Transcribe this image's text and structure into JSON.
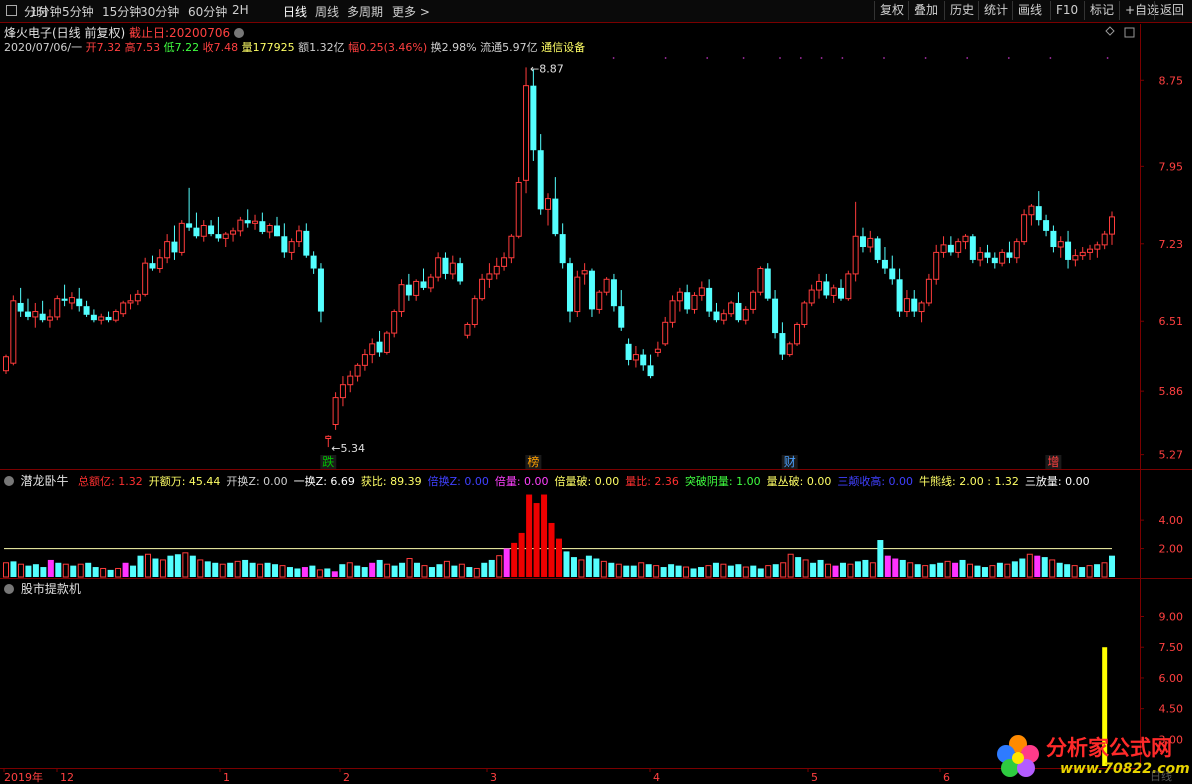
{
  "toolbar": {
    "left": [
      "分时",
      "1分钟",
      "5分钟",
      "15分钟",
      "30分钟",
      "60分钟",
      "2H",
      "日线",
      "周线",
      "多周期",
      "更多 >"
    ],
    "active": "日线",
    "right": [
      "复权",
      "叠加",
      "历史",
      "统计",
      "画线",
      "F10",
      "标记",
      "+自选",
      "返回"
    ]
  },
  "header": {
    "name": "烽火电子(日线 前复权)",
    "cutoff": "截止日:20200706",
    "date": "2020/07/06/一",
    "open": "开7.32",
    "high": "高7.53",
    "low": "低7.22",
    "close": "收7.48",
    "volume": "量177925",
    "amount": "额1.32亿",
    "change": "幅0.25(3.46%)",
    "turnover": "换2.98%",
    "float": "流通5.97亿",
    "sector": "通信设备"
  },
  "indicator1": {
    "name": "潜龙卧牛",
    "items": [
      {
        "text": "总额亿: 1.32",
        "color": "#ff3030"
      },
      {
        "text": "开额万: 45.44",
        "color": "#ffff66"
      },
      {
        "text": "开换Z: 0.00",
        "color": "#d0d0d0"
      },
      {
        "text": "一换Z: 6.69",
        "color": "#ffffff"
      },
      {
        "text": "获比: 89.39",
        "color": "#ffff66"
      },
      {
        "text": "倍换Z: 0.00",
        "color": "#4040ff"
      },
      {
        "text": "倍量: 0.00",
        "color": "#ff40ff"
      },
      {
        "text": "倍量破: 0.00",
        "color": "#ffff66"
      },
      {
        "text": "量比: 2.36",
        "color": "#ff3030"
      },
      {
        "text": "突破阴量: 1.00",
        "color": "#40ff40"
      },
      {
        "text": "量丛破: 0.00",
        "color": "#ffff66"
      },
      {
        "text": "三颠收高: 0.00",
        "color": "#4040ff"
      },
      {
        "text": "牛熊线: 2.00 : 1.32",
        "color": "#ffff66"
      },
      {
        "text": "三放量: 0.00",
        "color": "#ffffff"
      }
    ]
  },
  "indicator2": {
    "name": "股市提款机"
  },
  "logo": {
    "title": "分析家公式网",
    "url": "www.70822.com",
    "corner": "日线"
  },
  "chart_data": [
    {
      "type": "candlestick",
      "yticks": [
        8.75,
        7.95,
        7.23,
        6.51,
        5.86,
        5.27
      ],
      "ylim": [
        5.22,
        8.92
      ],
      "xticks": [
        "2019年",
        "12",
        "1",
        "2",
        "3",
        "4",
        "5",
        "6"
      ],
      "annotations": [
        {
          "text": "8.87",
          "kind": "high"
        },
        {
          "text": "5.34",
          "kind": "low"
        },
        {
          "text": "跌",
          "color": "#00c000"
        },
        {
          "text": "榜",
          "color": "#ffa000"
        },
        {
          "text": "财",
          "color": "#4aa0ff"
        },
        {
          "text": "增",
          "color": "#ff4040"
        }
      ],
      "ohlc": [
        [
          6.05,
          6.2,
          6.02,
          6.18
        ],
        [
          6.12,
          6.75,
          6.1,
          6.7
        ],
        [
          6.68,
          6.82,
          6.55,
          6.6
        ],
        [
          6.6,
          6.72,
          6.52,
          6.55
        ],
        [
          6.55,
          6.68,
          6.45,
          6.6
        ],
        [
          6.58,
          6.7,
          6.5,
          6.52
        ],
        [
          6.52,
          6.62,
          6.45,
          6.55
        ],
        [
          6.55,
          6.75,
          6.52,
          6.72
        ],
        [
          6.72,
          6.85,
          6.65,
          6.7
        ],
        [
          6.68,
          6.78,
          6.62,
          6.73
        ],
        [
          6.72,
          6.82,
          6.6,
          6.65
        ],
        [
          6.65,
          6.7,
          6.55,
          6.57
        ],
        [
          6.57,
          6.62,
          6.5,
          6.52
        ],
        [
          6.52,
          6.58,
          6.48,
          6.55
        ],
        [
          6.55,
          6.6,
          6.5,
          6.52
        ],
        [
          6.52,
          6.62,
          6.5,
          6.6
        ],
        [
          6.58,
          6.7,
          6.55,
          6.68
        ],
        [
          6.68,
          6.76,
          6.62,
          6.7
        ],
        [
          6.7,
          6.8,
          6.66,
          6.76
        ],
        [
          6.76,
          7.1,
          6.74,
          7.05
        ],
        [
          7.05,
          7.12,
          6.98,
          7.0
        ],
        [
          7.0,
          7.18,
          6.96,
          7.1
        ],
        [
          7.1,
          7.32,
          7.05,
          7.25
        ],
        [
          7.25,
          7.4,
          7.08,
          7.15
        ],
        [
          7.15,
          7.45,
          7.12,
          7.42
        ],
        [
          7.42,
          7.75,
          7.35,
          7.38
        ],
        [
          7.38,
          7.52,
          7.28,
          7.3
        ],
        [
          7.3,
          7.45,
          7.25,
          7.4
        ],
        [
          7.4,
          7.45,
          7.3,
          7.32
        ],
        [
          7.32,
          7.48,
          7.25,
          7.28
        ],
        [
          7.28,
          7.34,
          7.2,
          7.32
        ],
        [
          7.32,
          7.38,
          7.25,
          7.35
        ],
        [
          7.35,
          7.48,
          7.3,
          7.45
        ],
        [
          7.45,
          7.55,
          7.38,
          7.42
        ],
        [
          7.42,
          7.5,
          7.36,
          7.44
        ],
        [
          7.44,
          7.52,
          7.32,
          7.34
        ],
        [
          7.34,
          7.42,
          7.28,
          7.4
        ],
        [
          7.4,
          7.48,
          7.3,
          7.3
        ],
        [
          7.3,
          7.42,
          7.1,
          7.15
        ],
        [
          7.15,
          7.28,
          7.08,
          7.25
        ],
        [
          7.25,
          7.4,
          7.2,
          7.35
        ],
        [
          7.35,
          7.42,
          7.1,
          7.12
        ],
        [
          7.12,
          7.16,
          6.95,
          7.0
        ],
        [
          7.0,
          7.05,
          6.5,
          6.6
        ],
        [
          5.42,
          5.45,
          5.34,
          5.44
        ],
        [
          5.55,
          5.85,
          5.5,
          5.8
        ],
        [
          5.8,
          6.0,
          5.72,
          5.92
        ],
        [
          5.92,
          6.05,
          5.85,
          6.0
        ],
        [
          6.0,
          6.12,
          5.95,
          6.1
        ],
        [
          6.1,
          6.25,
          6.05,
          6.2
        ],
        [
          6.2,
          6.35,
          6.12,
          6.3
        ],
        [
          6.32,
          6.42,
          6.18,
          6.22
        ],
        [
          6.22,
          6.42,
          6.2,
          6.4
        ],
        [
          6.4,
          6.62,
          6.36,
          6.6
        ],
        [
          6.6,
          6.9,
          6.55,
          6.85
        ],
        [
          6.85,
          6.95,
          6.7,
          6.75
        ],
        [
          6.75,
          6.9,
          6.7,
          6.88
        ],
        [
          6.88,
          7.0,
          6.8,
          6.82
        ],
        [
          6.82,
          6.95,
          6.78,
          6.92
        ],
        [
          6.92,
          7.15,
          6.88,
          7.1
        ],
        [
          7.1,
          7.15,
          6.9,
          6.95
        ],
        [
          6.95,
          7.12,
          6.9,
          7.05
        ],
        [
          7.05,
          7.1,
          6.85,
          6.88
        ],
        [
          6.38,
          6.5,
          6.35,
          6.48
        ],
        [
          6.48,
          6.75,
          6.45,
          6.72
        ],
        [
          6.72,
          6.95,
          6.7,
          6.9
        ],
        [
          6.9,
          7.05,
          6.82,
          6.95
        ],
        [
          6.95,
          7.1,
          6.9,
          7.02
        ],
        [
          7.02,
          7.15,
          6.98,
          7.1
        ],
        [
          7.1,
          7.32,
          7.05,
          7.3
        ],
        [
          7.3,
          7.85,
          7.28,
          7.8
        ],
        [
          7.82,
          8.87,
          7.7,
          8.7
        ],
        [
          8.7,
          8.85,
          8.0,
          8.1
        ],
        [
          8.1,
          8.25,
          7.5,
          7.55
        ],
        [
          7.55,
          7.7,
          7.4,
          7.65
        ],
        [
          7.65,
          7.85,
          7.3,
          7.32
        ],
        [
          7.32,
          7.42,
          7.0,
          7.05
        ],
        [
          7.05,
          7.1,
          6.5,
          6.6
        ],
        [
          6.6,
          6.98,
          6.55,
          6.92
        ],
        [
          6.95,
          7.05,
          6.85,
          6.98
        ],
        [
          6.98,
          7.0,
          6.55,
          6.62
        ],
        [
          6.62,
          6.8,
          6.58,
          6.78
        ],
        [
          6.78,
          6.92,
          6.75,
          6.9
        ],
        [
          6.9,
          6.95,
          6.6,
          6.65
        ],
        [
          6.65,
          6.8,
          6.42,
          6.45
        ],
        [
          6.3,
          6.35,
          6.1,
          6.15
        ],
        [
          6.15,
          6.28,
          6.08,
          6.2
        ],
        [
          6.2,
          6.25,
          6.05,
          6.1
        ],
        [
          6.1,
          6.2,
          5.98,
          6.0
        ],
        [
          6.22,
          6.32,
          6.18,
          6.25
        ],
        [
          6.3,
          6.55,
          6.28,
          6.5
        ],
        [
          6.5,
          6.75,
          6.45,
          6.7
        ],
        [
          6.7,
          6.82,
          6.6,
          6.78
        ],
        [
          6.78,
          6.85,
          6.58,
          6.62
        ],
        [
          6.62,
          6.78,
          6.58,
          6.75
        ],
        [
          6.75,
          6.88,
          6.7,
          6.82
        ],
        [
          6.82,
          6.9,
          6.55,
          6.6
        ],
        [
          6.6,
          6.68,
          6.5,
          6.52
        ],
        [
          6.52,
          6.62,
          6.48,
          6.58
        ],
        [
          6.58,
          6.7,
          6.55,
          6.68
        ],
        [
          6.68,
          6.78,
          6.5,
          6.52
        ],
        [
          6.52,
          6.65,
          6.48,
          6.62
        ],
        [
          6.62,
          6.8,
          6.58,
          6.78
        ],
        [
          6.78,
          7.02,
          6.75,
          7.0
        ],
        [
          7.0,
          7.05,
          6.7,
          6.72
        ],
        [
          6.72,
          6.8,
          6.35,
          6.4
        ],
        [
          6.4,
          6.5,
          6.15,
          6.2
        ],
        [
          6.2,
          6.32,
          6.18,
          6.3
        ],
        [
          6.3,
          6.5,
          6.28,
          6.48
        ],
        [
          6.48,
          6.7,
          6.45,
          6.68
        ],
        [
          6.68,
          6.85,
          6.65,
          6.8
        ],
        [
          6.8,
          6.95,
          6.72,
          6.88
        ],
        [
          6.88,
          6.95,
          6.72,
          6.75
        ],
        [
          6.75,
          6.85,
          6.68,
          6.82
        ],
        [
          6.82,
          6.9,
          6.7,
          6.72
        ],
        [
          6.72,
          6.98,
          6.7,
          6.95
        ],
        [
          6.95,
          7.62,
          6.88,
          7.3
        ],
        [
          7.3,
          7.38,
          7.15,
          7.2
        ],
        [
          7.2,
          7.35,
          7.15,
          7.28
        ],
        [
          7.28,
          7.3,
          7.05,
          7.08
        ],
        [
          7.08,
          7.2,
          6.95,
          7.0
        ],
        [
          7.0,
          7.12,
          6.85,
          6.9
        ],
        [
          6.9,
          7.0,
          6.55,
          6.6
        ],
        [
          6.6,
          6.8,
          6.55,
          6.72
        ],
        [
          6.72,
          6.8,
          6.55,
          6.6
        ],
        [
          6.6,
          6.7,
          6.5,
          6.68
        ],
        [
          6.68,
          6.95,
          6.65,
          6.9
        ],
        [
          6.9,
          7.22,
          6.85,
          7.15
        ],
        [
          7.15,
          7.3,
          7.1,
          7.22
        ],
        [
          7.22,
          7.3,
          7.12,
          7.15
        ],
        [
          7.15,
          7.28,
          7.1,
          7.25
        ],
        [
          7.25,
          7.32,
          7.18,
          7.3
        ],
        [
          7.3,
          7.32,
          7.05,
          7.08
        ],
        [
          7.08,
          7.2,
          7.02,
          7.15
        ],
        [
          7.15,
          7.22,
          7.05,
          7.1
        ],
        [
          7.1,
          7.15,
          7.0,
          7.05
        ],
        [
          7.05,
          7.18,
          7.02,
          7.15
        ],
        [
          7.15,
          7.25,
          7.05,
          7.1
        ],
        [
          7.1,
          7.28,
          7.05,
          7.25
        ],
        [
          7.25,
          7.55,
          7.22,
          7.5
        ],
        [
          7.5,
          7.6,
          7.4,
          7.58
        ],
        [
          7.58,
          7.72,
          7.4,
          7.45
        ],
        [
          7.45,
          7.5,
          7.3,
          7.35
        ],
        [
          7.35,
          7.4,
          7.15,
          7.2
        ],
        [
          7.2,
          7.3,
          7.1,
          7.25
        ],
        [
          7.25,
          7.35,
          7.0,
          7.08
        ],
        [
          7.08,
          7.18,
          7.02,
          7.12
        ],
        [
          7.12,
          7.2,
          7.08,
          7.15
        ],
        [
          7.15,
          7.22,
          7.08,
          7.18
        ],
        [
          7.18,
          7.25,
          7.1,
          7.22
        ],
        [
          7.22,
          7.35,
          7.18,
          7.32
        ],
        [
          7.32,
          7.53,
          7.22,
          7.48
        ]
      ]
    },
    {
      "type": "bar",
      "name": "潜龙卧牛",
      "yticks": [
        4.0,
        2.0
      ],
      "ylim": [
        0,
        6.4
      ],
      "reference_line": 2.0,
      "values": [
        1.0,
        1.1,
        0.9,
        0.8,
        0.9,
        0.7,
        1.2,
        1.0,
        0.9,
        0.8,
        0.9,
        1.0,
        0.7,
        0.6,
        0.5,
        0.6,
        1.0,
        0.8,
        1.5,
        1.6,
        1.3,
        1.2,
        1.5,
        1.6,
        1.7,
        1.5,
        1.2,
        1.1,
        1.0,
        0.9,
        1.0,
        1.1,
        1.2,
        1.0,
        0.9,
        1.0,
        0.9,
        0.8,
        0.7,
        0.6,
        0.7,
        0.8,
        0.5,
        0.6,
        0.4,
        0.9,
        1.0,
        0.8,
        0.7,
        1.0,
        1.2,
        0.9,
        0.8,
        1.0,
        1.3,
        1.0,
        0.8,
        0.7,
        0.9,
        1.1,
        0.8,
        0.9,
        0.7,
        0.6,
        1.0,
        1.2,
        1.5,
        2.0,
        2.4,
        3.1,
        5.8,
        5.2,
        5.8,
        3.8,
        2.7,
        1.8,
        1.4,
        1.2,
        1.5,
        1.3,
        1.1,
        1.0,
        0.9,
        0.8,
        0.8,
        1.0,
        0.9,
        0.8,
        0.7,
        0.9,
        0.8,
        0.7,
        0.6,
        0.7,
        0.8,
        1.0,
        0.9,
        0.8,
        0.9,
        0.7,
        0.8,
        0.6,
        0.8,
        0.9,
        1.0,
        1.6,
        1.4,
        1.2,
        1.0,
        1.2,
        0.9,
        0.8,
        1.0,
        0.9,
        1.1,
        1.2,
        1.0,
        2.6,
        1.5,
        1.3,
        1.2,
        1.0,
        0.9,
        0.8,
        0.9,
        1.0,
        1.1,
        1.0,
        1.2,
        0.9,
        0.8,
        0.7,
        0.8,
        1.0,
        0.9,
        1.1,
        1.3,
        1.6,
        1.5,
        1.4,
        1.2,
        1.0,
        0.9,
        0.8,
        0.7,
        0.8,
        0.9,
        1.0,
        1.5
      ],
      "colors": [
        "r",
        "c",
        "r",
        "c",
        "c",
        "c",
        "m",
        "c",
        "r",
        "c",
        "r",
        "c",
        "c",
        "r",
        "c",
        "r",
        "m",
        "c",
        "c",
        "r",
        "c",
        "r",
        "c",
        "c",
        "r",
        "c",
        "r",
        "c",
        "c",
        "r",
        "c",
        "r",
        "c",
        "c",
        "r",
        "c",
        "c",
        "r",
        "c",
        "c",
        "m",
        "c",
        "r",
        "c",
        "m",
        "c",
        "r",
        "c",
        "c",
        "m",
        "c",
        "r",
        "c",
        "c",
        "r",
        "c",
        "r",
        "c",
        "c",
        "r",
        "c",
        "r",
        "c",
        "r",
        "c",
        "c",
        "r",
        "m",
        "R",
        "R",
        "R",
        "R",
        "R",
        "R",
        "R",
        "c",
        "c",
        "r",
        "c",
        "c",
        "r",
        "c",
        "r",
        "c",
        "c",
        "r",
        "c",
        "r",
        "c",
        "c",
        "c",
        "r",
        "c",
        "c",
        "r",
        "c",
        "r",
        "c",
        "c",
        "r",
        "c",
        "c",
        "r",
        "c",
        "r",
        "r",
        "c",
        "r",
        "c",
        "c",
        "r",
        "m",
        "c",
        "r",
        "c",
        "c",
        "r",
        "c",
        "m",
        "m",
        "c",
        "r",
        "c",
        "r",
        "c",
        "c",
        "r",
        "m",
        "c",
        "r",
        "c",
        "c",
        "r",
        "c",
        "r",
        "c",
        "c",
        "r",
        "m",
        "c",
        "r",
        "c",
        "c",
        "r",
        "c",
        "r",
        "c",
        "r",
        "c",
        "r"
      ]
    },
    {
      "type": "bar",
      "name": "股市提款机",
      "yticks": [
        9.0,
        7.5,
        6.0,
        4.5,
        3.0
      ],
      "ylim": [
        1.8,
        10.0
      ],
      "signal": {
        "index": 150,
        "value": 7.5
      }
    }
  ]
}
